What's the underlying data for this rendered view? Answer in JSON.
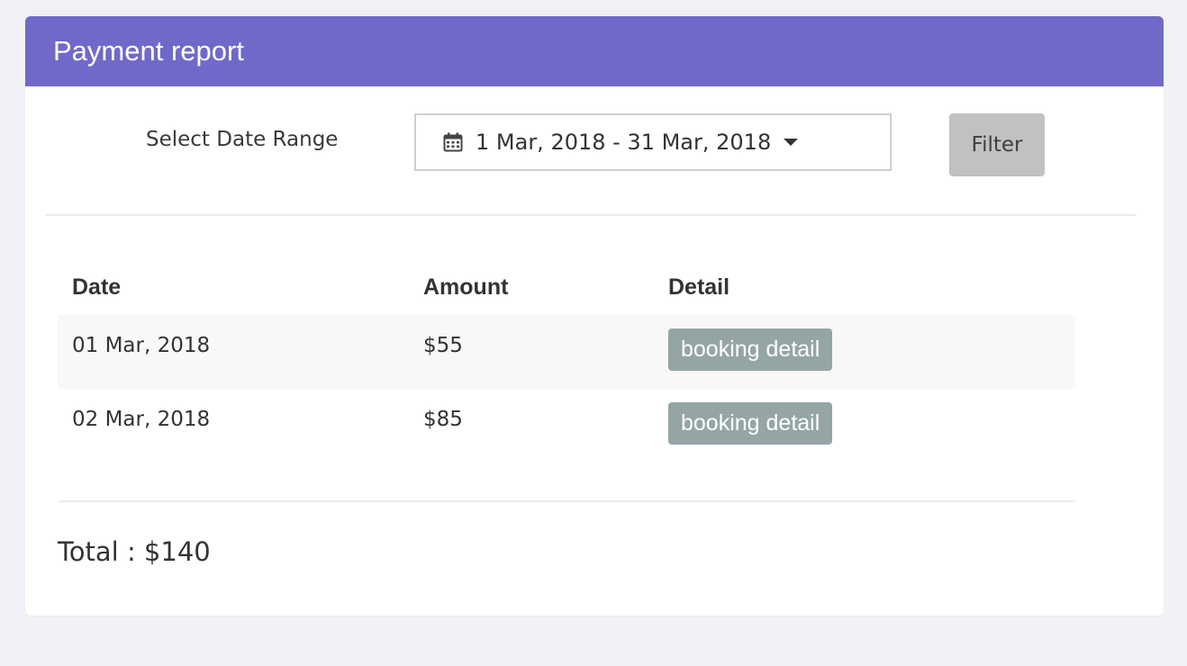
{
  "header": {
    "title": "Payment report"
  },
  "filter": {
    "label": "Select Date Range",
    "date_range": "1 Mar, 2018 - 31 Mar, 2018",
    "button_label": "Filter",
    "calendar_icon": "calendar-icon",
    "caret_icon": "caret-down-icon"
  },
  "table": {
    "headers": [
      "Date",
      "Amount",
      "Detail"
    ],
    "rows": [
      {
        "date": "01 Mar, 2018",
        "amount": "$55",
        "detail_label": "booking detail"
      },
      {
        "date": "02 Mar, 2018",
        "amount": "$85",
        "detail_label": "booking detail"
      }
    ]
  },
  "total": {
    "text": "Total : $140"
  },
  "colors": {
    "header_bg": "#7169c9",
    "filter_button_bg": "#c1c1c1",
    "detail_button_bg": "#95a5a6",
    "page_bg": "#f1f2f7"
  }
}
